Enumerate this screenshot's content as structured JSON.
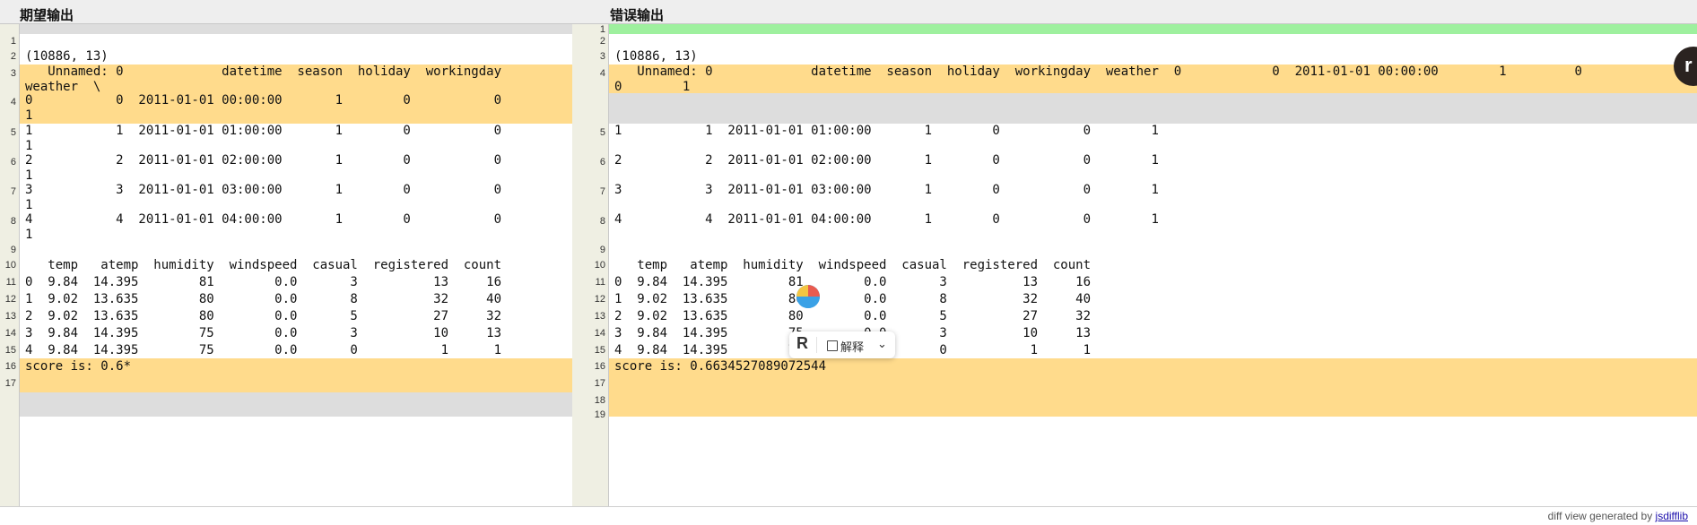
{
  "left_title": "期望输出",
  "right_title": "错误输出",
  "footer": {
    "prefix": "diff view generated by ",
    "link": "jsdifflib"
  },
  "left_rows": [
    {
      "ln": "",
      "cls": "empty",
      "text": ""
    },
    {
      "ln": "1",
      "cls": "equal",
      "text": ""
    },
    {
      "ln": "2",
      "cls": "equal",
      "text": "(10886, 13)"
    },
    {
      "ln": "3",
      "cls": "replace",
      "text": "   Unnamed: 0             datetime  season  holiday  workingday\nweather  \\"
    },
    {
      "ln": "4",
      "cls": "replace",
      "text": "0           0  2011-01-01 00:00:00       1        0           0\n1"
    },
    {
      "ln": "5",
      "cls": "equal",
      "text": "1           1  2011-01-01 01:00:00       1        0           0\n1"
    },
    {
      "ln": "6",
      "cls": "equal",
      "text": "2           2  2011-01-01 02:00:00       1        0           0\n1"
    },
    {
      "ln": "7",
      "cls": "equal",
      "text": "3           3  2011-01-01 03:00:00       1        0           0\n1"
    },
    {
      "ln": "8",
      "cls": "equal",
      "text": "4           4  2011-01-01 04:00:00       1        0           0\n1"
    },
    {
      "ln": "9",
      "cls": "equal",
      "text": ""
    },
    {
      "ln": "10",
      "cls": "equal",
      "text": "   temp   atemp  humidity  windspeed  casual  registered  count"
    },
    {
      "ln": "11",
      "cls": "equal",
      "text": "0  9.84  14.395        81        0.0       3          13     16"
    },
    {
      "ln": "12",
      "cls": "equal",
      "text": "1  9.02  13.635        80        0.0       8          32     40"
    },
    {
      "ln": "13",
      "cls": "equal",
      "text": "2  9.02  13.635        80        0.0       5          27     32"
    },
    {
      "ln": "14",
      "cls": "equal",
      "text": "3  9.84  14.395        75        0.0       3          10     13"
    },
    {
      "ln": "15",
      "cls": "equal",
      "text": "4  9.84  14.395        75        0.0       0           1      1"
    },
    {
      "ln": "16",
      "cls": "replace",
      "text": "score is: 0.6*"
    },
    {
      "ln": "17",
      "cls": "replace",
      "text": ""
    },
    {
      "ln": "",
      "cls": "empty",
      "text": ""
    },
    {
      "ln": "",
      "cls": "empty",
      "text": ""
    }
  ],
  "right_rows": [
    {
      "ln": "1",
      "cls": "insert",
      "text": ""
    },
    {
      "ln": "2",
      "cls": "equal",
      "text": ""
    },
    {
      "ln": "3",
      "cls": "equal",
      "text": "(10886, 13)"
    },
    {
      "ln": "4",
      "cls": "replace",
      "text": "   Unnamed: 0             datetime  season  holiday  workingday  weather  0            0  2011-01-01 00:00:00        1         0\n0        1"
    },
    {
      "ln": "",
      "cls": "empty",
      "text": ""
    },
    {
      "ln": "5",
      "cls": "equal",
      "text": "1           1  2011-01-01 01:00:00       1        0           0        1"
    },
    {
      "ln": "6",
      "cls": "equal",
      "text": "2           2  2011-01-01 02:00:00       1        0           0        1"
    },
    {
      "ln": "7",
      "cls": "equal",
      "text": "3           3  2011-01-01 03:00:00       1        0           0        1"
    },
    {
      "ln": "8",
      "cls": "equal",
      "text": "4           4  2011-01-01 04:00:00       1        0           0        1"
    },
    {
      "ln": "9",
      "cls": "equal",
      "text": ""
    },
    {
      "ln": "10",
      "cls": "equal",
      "text": "   temp   atemp  humidity  windspeed  casual  registered  count"
    },
    {
      "ln": "11",
      "cls": "equal",
      "text": "0  9.84  14.395        81        0.0       3          13     16"
    },
    {
      "ln": "12",
      "cls": "equal",
      "text": "1  9.02  13.635        80        0.0       8          32     40"
    },
    {
      "ln": "13",
      "cls": "equal",
      "text": "2  9.02  13.635        80        0.0       5          27     32"
    },
    {
      "ln": "14",
      "cls": "equal",
      "text": "3  9.84  14.395        75        0.0       3          10     13"
    },
    {
      "ln": "15",
      "cls": "equal",
      "text": "4  9.84  14.395        75        0.0       0           1      1"
    },
    {
      "ln": "16",
      "cls": "replace",
      "text": "score is: 0.6634527089072544"
    },
    {
      "ln": "17",
      "cls": "replace",
      "text": ""
    },
    {
      "ln": "18",
      "cls": "replace",
      "text": ""
    },
    {
      "ln": "19",
      "cls": "replace",
      "text": ""
    }
  ],
  "popup": {
    "brand_glyph": "R",
    "action_label": "解释",
    "chevron": "⌄"
  },
  "edge_button_glyph": "r",
  "colors": {
    "replace": "#ffdb8c",
    "insert": "#9ef09e",
    "empty": "#dddddd"
  }
}
